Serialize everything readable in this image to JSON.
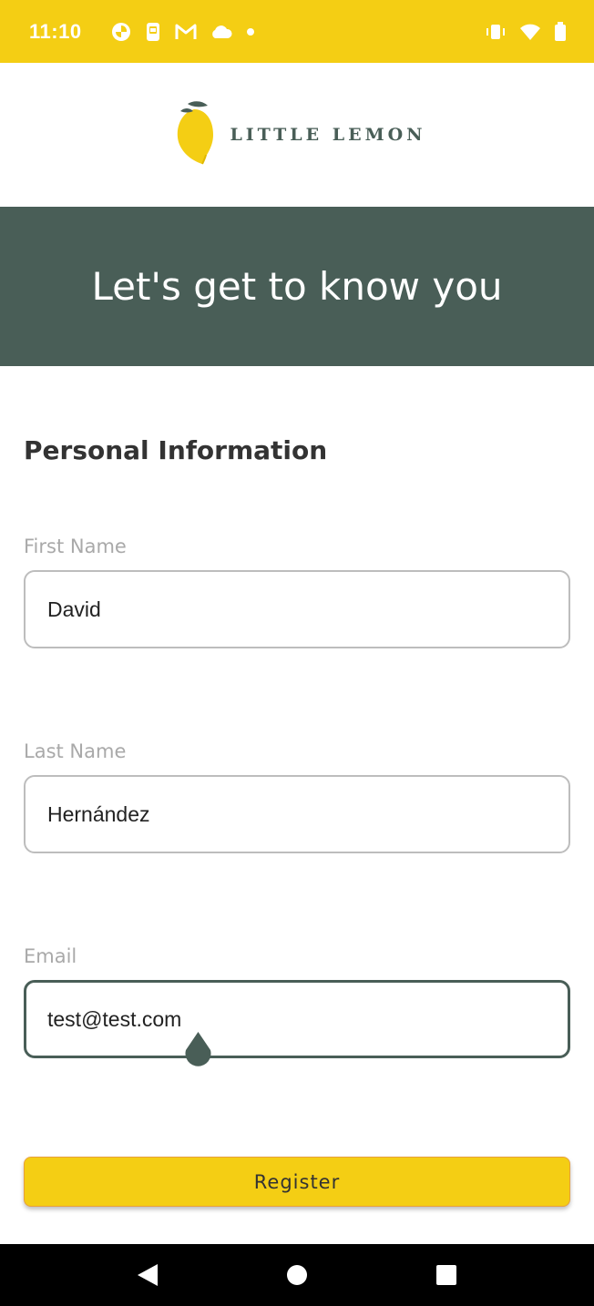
{
  "status_bar": {
    "time": "11:10",
    "left_icons": [
      "pinwheel-app-icon",
      "phone-screen-icon",
      "gmail-icon",
      "cloud-icon",
      "dot-icon"
    ],
    "right_icons": [
      "vibrate-icon",
      "wifi-icon",
      "battery-icon"
    ],
    "background_color": "#f4ce14"
  },
  "header": {
    "brand": "LITTLE LEMON",
    "logo_icon": "lemon-icon"
  },
  "hero": {
    "title": "Let's get to know you",
    "background_color": "#495e57"
  },
  "form": {
    "section_title": "Personal Information",
    "first_name": {
      "label": "First Name",
      "value": "David"
    },
    "last_name": {
      "label": "Last Name",
      "value": "Hernández"
    },
    "email": {
      "label": "Email",
      "value": "test@test.com"
    },
    "register_label": "Register",
    "accent_color": "#495e57",
    "button_color": "#f4ce14"
  },
  "nav_bar": {
    "icons": [
      "back-icon",
      "home-icon",
      "recents-icon"
    ]
  }
}
